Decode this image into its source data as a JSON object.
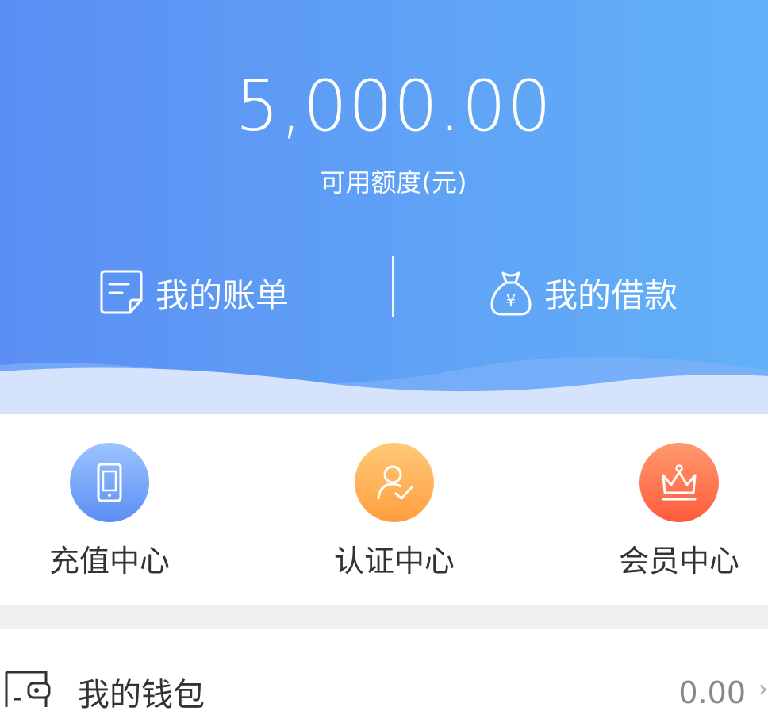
{
  "header": {
    "amount": "5,000.00",
    "amount_label": "可用额度(元)",
    "bill_button_label": "我的账单",
    "loan_button_label": "我的借款"
  },
  "quick_actions": [
    {
      "label": "充值中心",
      "icon": "phone-icon",
      "color_top": "#9cc4ff",
      "color_bottom": "#5b8ef4"
    },
    {
      "label": "认证中心",
      "icon": "user-check-icon",
      "color_top": "#ffc978",
      "color_bottom": "#ff9f3e"
    },
    {
      "label": "会员中心",
      "icon": "crown-icon",
      "color_top": "#ff9a6e",
      "color_bottom": "#ff5b3c"
    }
  ],
  "wallet": {
    "label": "我的钱包",
    "value": "0.00"
  },
  "colors": {
    "hero_start": "#5b8ef4",
    "hero_end": "#62b1f8"
  }
}
